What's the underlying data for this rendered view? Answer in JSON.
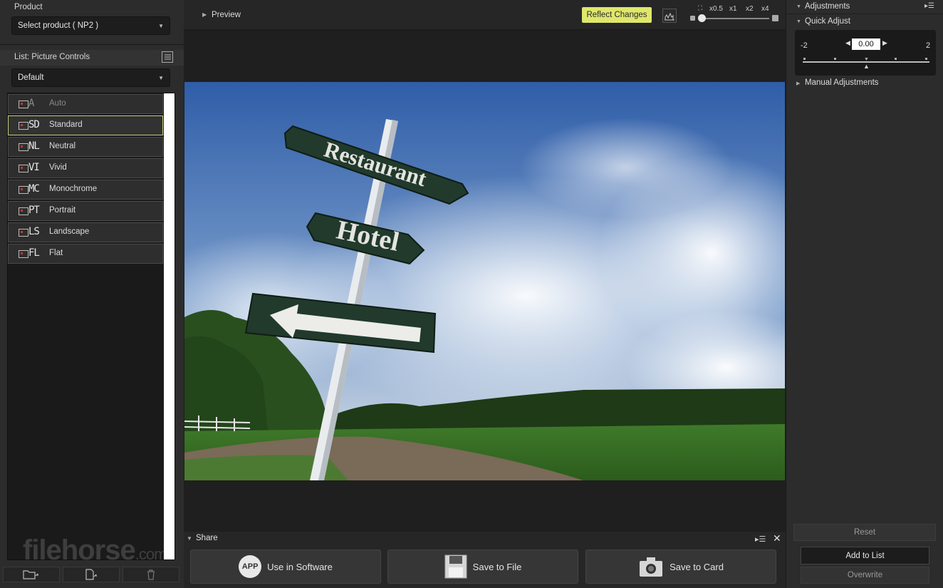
{
  "left": {
    "product_title": "Product",
    "product_select": "Select product ( NP2 )",
    "list_title": "List: Picture Controls",
    "list_select": "Default",
    "items": [
      {
        "abbr": "A",
        "label": "Auto"
      },
      {
        "abbr": "SD",
        "label": "Standard"
      },
      {
        "abbr": "NL",
        "label": "Neutral"
      },
      {
        "abbr": "VI",
        "label": "Vivid"
      },
      {
        "abbr": "MC",
        "label": "Monochrome"
      },
      {
        "abbr": "PT",
        "label": "Portrait"
      },
      {
        "abbr": "LS",
        "label": "Landscape"
      },
      {
        "abbr": "FL",
        "label": "Flat"
      }
    ],
    "selected_item": "Standard",
    "watermark_main": "filehorse",
    "watermark_suffix": ".com"
  },
  "preview": {
    "title": "Preview",
    "reflect_label": "Reflect Changes",
    "zoom_levels": [
      "x0.5",
      "x1",
      "x2",
      "x4"
    ],
    "current_zoom": "x0.5",
    "photo_text": {
      "sign1": "Restaurant",
      "sign2": "Hotel"
    }
  },
  "share": {
    "title": "Share",
    "use_software": "Use in Software",
    "app_badge": "APP",
    "save_file": "Save to File",
    "save_card": "Save to Card"
  },
  "right": {
    "adjustments_title": "Adjustments",
    "quick_adjust_title": "Quick Adjust",
    "min_label": "-2",
    "max_label": "2",
    "value": "0.00",
    "slider_value": 0,
    "manual_title": "Manual Adjustments",
    "reset_label": "Reset",
    "add_label": "Add to List",
    "overwrite_label": "Overwrite"
  },
  "colors": {
    "accent_yellow": "#dfe76c",
    "selected_border": "#c8d27a",
    "panel_bg": "#2c2c2c"
  }
}
